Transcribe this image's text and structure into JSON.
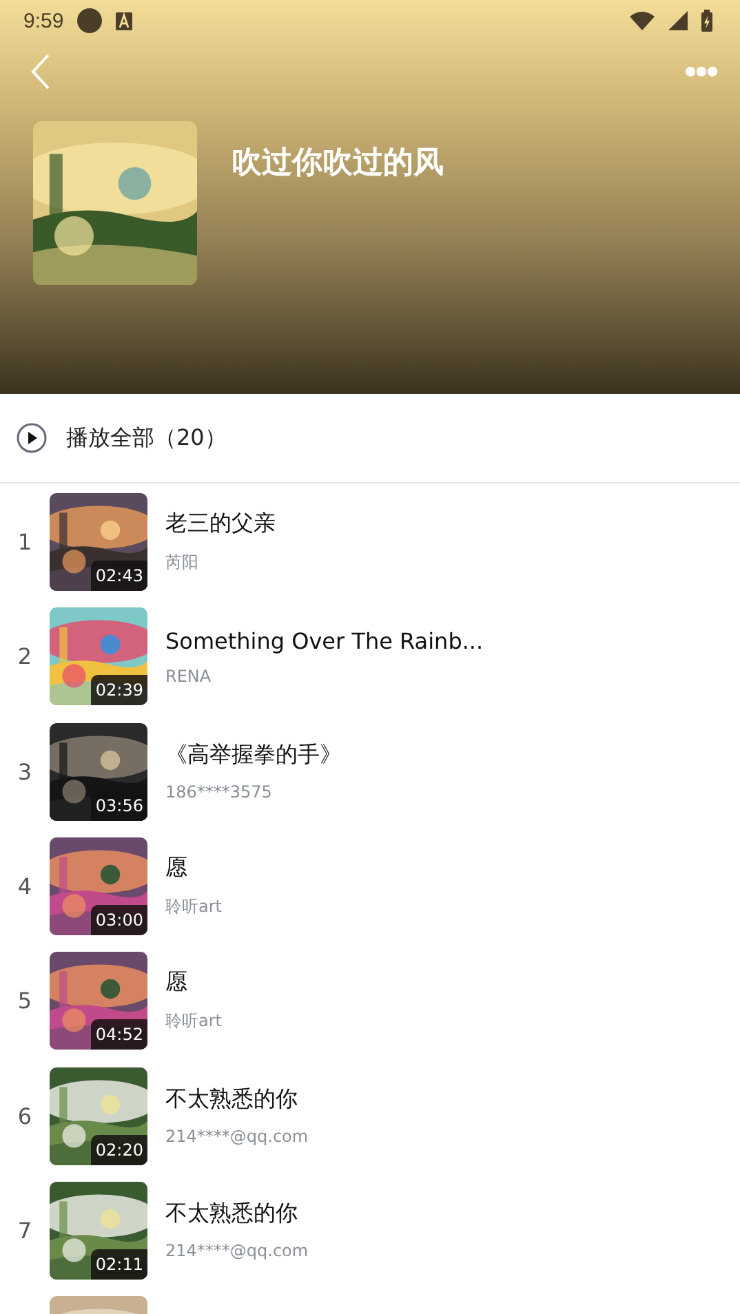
{
  "status_bar": {
    "time": "9:59"
  },
  "album": {
    "title": "吹过你吹过的风"
  },
  "play_all": {
    "label": "播放全部（20）"
  },
  "songs": [
    {
      "kind": "song",
      "number": "1",
      "title": "老三的父亲",
      "artist": "芮阳",
      "duration": "02:43"
    },
    {
      "kind": "song",
      "number": "2",
      "title": "Something Over The Rainb...",
      "artist": "RENA",
      "duration": "02:39"
    },
    {
      "kind": "song",
      "number": "3",
      "title": "《高举握拳的手》",
      "artist": "186****3575",
      "duration": "03:56"
    },
    {
      "kind": "song",
      "number": "4",
      "title": "愿",
      "artist": "聆听art",
      "duration": "03:00"
    },
    {
      "kind": "song",
      "number": "5",
      "title": "愿",
      "artist": "聆听art",
      "duration": "04:52"
    },
    {
      "kind": "song",
      "number": "6",
      "title": "不太熟悉的你",
      "artist": "214****@qq.com",
      "duration": "02:20"
    },
    {
      "kind": "song",
      "number": "7",
      "title": "不太熟悉的你",
      "artist": "214****@qq.com",
      "duration": "02:11"
    },
    {
      "kind": "peek"
    }
  ]
}
